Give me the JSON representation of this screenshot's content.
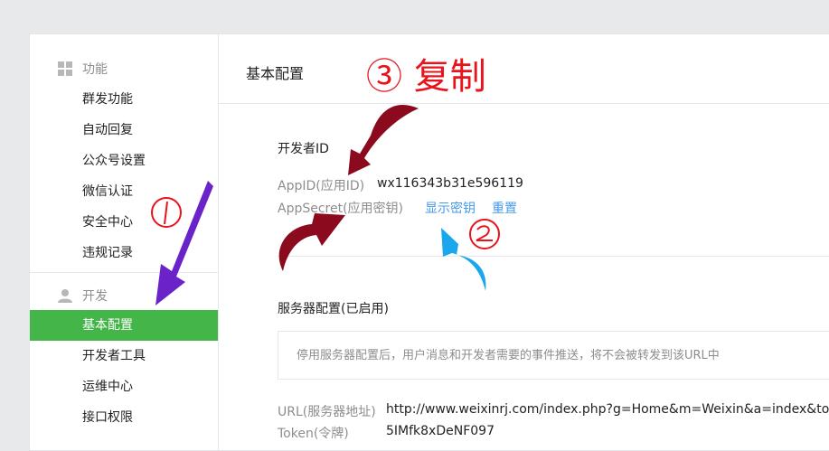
{
  "sidebar": {
    "group_function": {
      "icon": "grid-icon",
      "label": "功能"
    },
    "function_items": [
      "群发功能",
      "自动回复",
      "公众号设置",
      "微信认证",
      "安全中心",
      "违规记录"
    ],
    "group_develop": {
      "icon": "user-icon",
      "label": "开发"
    },
    "develop_items": [
      "基本配置",
      "开发者工具",
      "运维中心",
      "接口权限"
    ],
    "active_item": "基本配置"
  },
  "main": {
    "title": "基本配置",
    "developer": {
      "section_title": "开发者ID",
      "appid_label": "AppID(应用ID)",
      "appid_value": "wx116343b31e596119",
      "secret_label": "AppSecret(应用密钥)",
      "show_secret_link": "显示密钥",
      "reset_link": "重置"
    },
    "server": {
      "section_title": "服务器配置(已启用)",
      "notice": "停用服务器配置后，用户消息和开发者需要的事件推送，将不会被转发到该URL中",
      "url_label": "URL(服务器地址)",
      "url_value": "http://www.weixinrj.com/index.php?g=Home&m=Weixin&a=index&toke",
      "token_label": "Token(令牌)",
      "token_value": "5IMfk8xDeNF097"
    }
  },
  "annotations": {
    "step3_text": "③ 复制",
    "step1_text": "①",
    "step2_text": "②",
    "colors": {
      "step3": "#e8141c",
      "dark_arrow": "#8b0a1e",
      "purple_arrow": "#6a22c9",
      "blue_arrow": "#1aa7ec",
      "active_green": "#44b549",
      "link_blue": "#459ae9"
    }
  }
}
